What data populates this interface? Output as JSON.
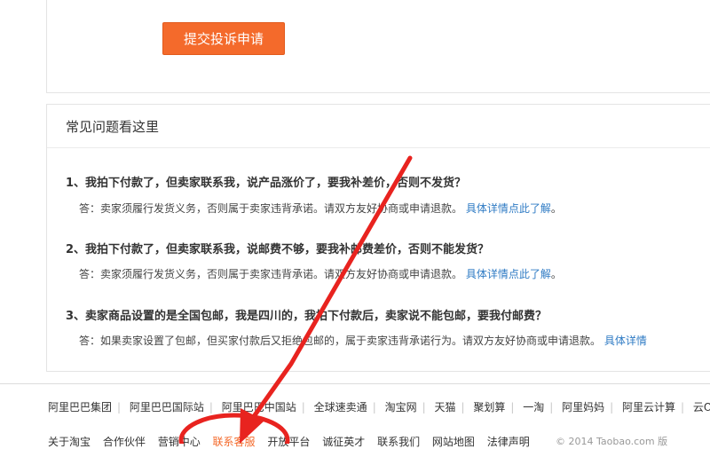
{
  "submit_button": "提交投诉申请",
  "faq": {
    "title": "常见问题看这里",
    "items": [
      {
        "question": "1、我拍下付款了，但卖家联系我，说产品涨价了，要我补差价，否则不发货？",
        "answer": "答：卖家须履行发货义务，否则属于卖家违背承诺。请双方友好协商或申请退款。",
        "link": "具体详情点此了解"
      },
      {
        "question": "2、我拍下付款了，但卖家联系我，说邮费不够，要我补邮费差价，否则不能发货？",
        "answer": "答：卖家须履行发货义务，否则属于卖家违背承诺。请双方友好协商或申请退款。",
        "link": "具体详情点此了解"
      },
      {
        "question": "3、卖家商品设置的是全国包邮，我是四川的，我拍下付款后，卖家说不能包邮，要我付邮费？",
        "answer": "答：如果卖家设置了包邮，但买家付款后又拒绝包邮的，属于卖家违背承诺行为。请双方友好协商或申请退款。",
        "link": "具体详情"
      }
    ]
  },
  "footer": {
    "group_links": [
      "阿里巴巴集团",
      "阿里巴巴国际站",
      "阿里巴巴中国站",
      "全球速卖通",
      "淘宝网",
      "天猫",
      "聚划算",
      "一淘",
      "阿里妈妈",
      "阿里云计算",
      "云OS"
    ],
    "bottom_links": [
      "关于淘宝",
      "合作伙伴",
      "营销中心",
      "联系客服",
      "开放平台",
      "诚征英才",
      "联系我们",
      "网站地图",
      "法律声明"
    ],
    "highlighted_link": "联系客服",
    "copyright": "© 2014 Taobao.com 版"
  },
  "colors": {
    "button_orange": "#f46a2b",
    "link_blue": "#2f7bc4",
    "annotation_red": "#e8231f"
  }
}
